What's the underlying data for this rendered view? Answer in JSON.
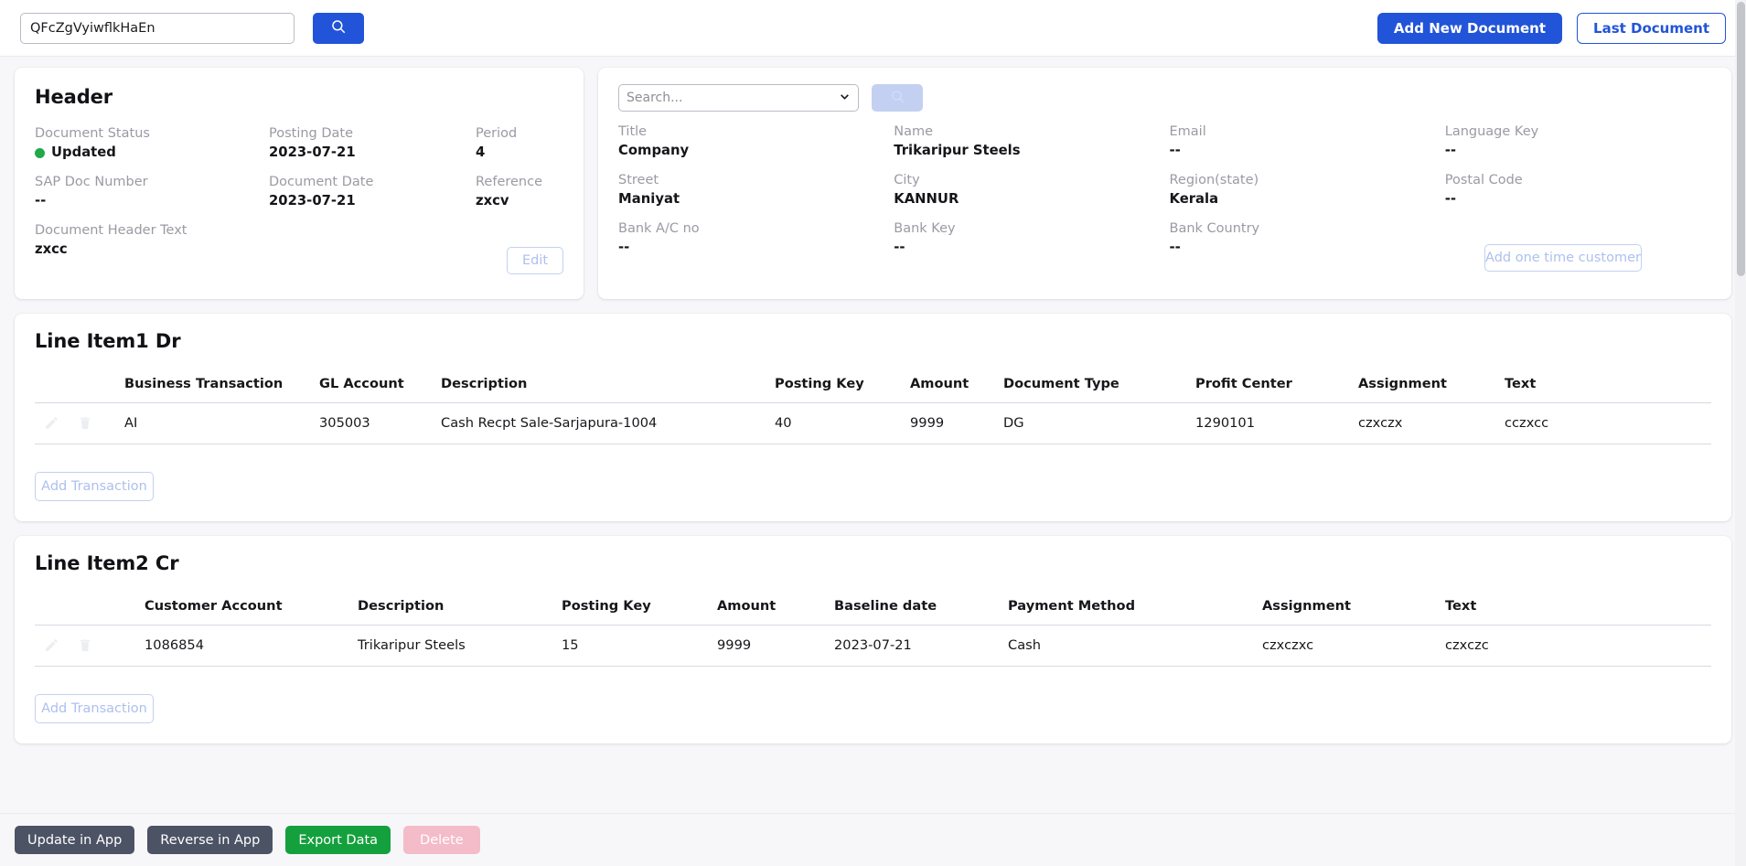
{
  "topbar": {
    "search_value": "QFcZgVyiwflkHaEn",
    "search_placeholder": "Search",
    "search_button_icon": "search-icon",
    "add_new_document": "Add New Document",
    "last_document": "Last Document"
  },
  "header_card": {
    "title": "Header",
    "fields": [
      {
        "label": "Document Status",
        "value": "Updated",
        "status": true
      },
      {
        "label": "Posting Date",
        "value": "2023-07-21"
      },
      {
        "label": "Period",
        "value": "4"
      },
      {
        "label": "SAP Doc Number",
        "value": "--"
      },
      {
        "label": "Document Date",
        "value": "2023-07-21"
      },
      {
        "label": "Reference",
        "value": "zxcv"
      },
      {
        "label": "Document Header Text",
        "value": "zxcc"
      }
    ],
    "edit_label": "Edit",
    "status_color": "#21a849"
  },
  "customer_card": {
    "search_placeholder": "Search...",
    "search_button_icon": "search-icon",
    "dropdown_icon": "chevron-down-icon",
    "add_one_time_customer": "Add one time customer",
    "fields": [
      {
        "label": "Title",
        "value": "Company"
      },
      {
        "label": "Name",
        "value": "Trikaripur Steels"
      },
      {
        "label": "Email",
        "value": "--"
      },
      {
        "label": "Language Key",
        "value": "--"
      },
      {
        "label": "Street",
        "value": "Maniyat"
      },
      {
        "label": "City",
        "value": "KANNUR"
      },
      {
        "label": "Region(state)",
        "value": "Kerala"
      },
      {
        "label": "Postal Code",
        "value": "--"
      },
      {
        "label": "Bank A/C no",
        "value": "--"
      },
      {
        "label": "Bank Key",
        "value": "--"
      },
      {
        "label": "Bank Country",
        "value": "--"
      },
      {
        "label": "",
        "value": ""
      }
    ]
  },
  "line_item_1": {
    "title": "Line Item1 Dr",
    "columns": [
      "",
      "Business Transaction",
      "GL Account",
      "Description",
      "Posting Key",
      "Amount",
      "Document Type",
      "Profit Center",
      "Assignment",
      "Text"
    ],
    "rows": [
      {
        "business_transaction": "AI",
        "gl_account": "305003",
        "description": "Cash Recpt Sale-Sarjapura-1004",
        "posting_key": "40",
        "amount": "9999",
        "document_type": "DG",
        "profit_center": "1290101",
        "assignment": "czxczx",
        "text": "cczxcc",
        "edit_icon": "pencil-icon",
        "delete_icon": "trash-icon"
      }
    ],
    "add_transaction": "Add Transaction"
  },
  "line_item_2": {
    "title": "Line Item2 Cr",
    "columns": [
      "",
      "Customer Account",
      "Description",
      "Posting Key",
      "Amount",
      "Baseline date",
      "Payment Method",
      "Assignment",
      "Text"
    ],
    "rows": [
      {
        "customer_account": "1086854",
        "description": "Trikaripur Steels",
        "posting_key": "15",
        "amount": "9999",
        "baseline_date": "2023-07-21",
        "payment_method": "Cash",
        "assignment": "czxczxc",
        "text": "czxczc",
        "edit_icon": "pencil-icon",
        "delete_icon": "trash-icon"
      }
    ],
    "add_transaction": "Add Transaction"
  },
  "footer": {
    "update_in_app": "Update in App",
    "reverse_in_app": "Reverse in App",
    "export_data": "Export Data",
    "delete": "Delete"
  },
  "colors": {
    "primary": "#2154d8",
    "green": "#14a03d",
    "slate": "#4b5364",
    "pink_disabled": "#f4bcc8",
    "status_green": "#21a849"
  }
}
